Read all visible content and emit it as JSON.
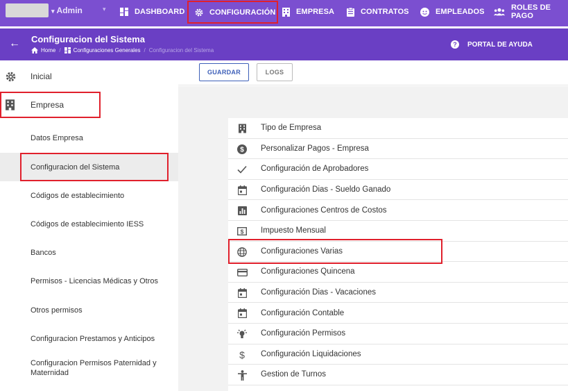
{
  "topbar": {
    "user": "Admin",
    "nav": [
      {
        "label": "DASHBOARD",
        "icon": "dashboard-icon"
      },
      {
        "label": "CONFIGURACIÓN",
        "icon": "gear-icon"
      },
      {
        "label": "EMPRESA",
        "icon": "building-icon"
      },
      {
        "label": "CONTRATOS",
        "icon": "clipboard-icon"
      },
      {
        "label": "EMPLEADOS",
        "icon": "face-icon"
      },
      {
        "label": "ROLES DE PAGO",
        "icon": "people-icon"
      }
    ]
  },
  "header": {
    "title": "Configuracion del Sistema",
    "breadcrumbs": [
      "Home",
      "Configuraciones Generales",
      "Configuracion del Sistema"
    ],
    "help_label": "PORTAL DE AYUDA"
  },
  "sidebar": {
    "top_items": [
      {
        "label": "Inicial",
        "icon": "gear-icon"
      },
      {
        "label": "Empresa",
        "icon": "building-icon"
      }
    ],
    "sub_items": [
      "Datos Empresa",
      "Configuracion del Sistema",
      "Códigos de establecimiento",
      "Códigos de establecimiento IESS",
      "Bancos",
      "Permisos - Licencias Médicas y Otros",
      "Otros permisos",
      "Configuracion Prestamos y Anticipos",
      "Configuracion Permisos Paternidad y Maternidad"
    ]
  },
  "toolbar": {
    "save_label": "GUARDAR",
    "logs_label": "LOGS"
  },
  "settings_list": [
    {
      "label": "Tipo de Empresa",
      "icon": "building-icon"
    },
    {
      "label": "Personalizar Pagos - Empresa",
      "icon": "dollar-circle-icon"
    },
    {
      "label": "Configuración de Aprobadores",
      "icon": "check-icon"
    },
    {
      "label": "Configuración Dias - Sueldo Ganado",
      "icon": "calendar-icon"
    },
    {
      "label": "Configuraciones Centros de Costos",
      "icon": "bar-chart-icon"
    },
    {
      "label": "Impuesto Mensual",
      "icon": "money-icon"
    },
    {
      "label": "Configuraciones Varias",
      "icon": "globe-icon"
    },
    {
      "label": "Configuraciones Quincena",
      "icon": "credit-card-icon"
    },
    {
      "label": "Configuración Dias - Vacaciones",
      "icon": "calendar-icon"
    },
    {
      "label": "Configuración Contable",
      "icon": "calendar-icon"
    },
    {
      "label": "Configuración Permisos",
      "icon": "lightbulb-icon"
    },
    {
      "label": "Configuración Liquidaciones",
      "icon": "dollar-icon"
    },
    {
      "label": "Gestion de Turnos",
      "icon": "person-icon"
    }
  ],
  "colors": {
    "topbar": "#7b4fd0",
    "subheader": "#6a3fc4",
    "highlight": "#e0202c",
    "accent_button": "#3d5fb8"
  }
}
